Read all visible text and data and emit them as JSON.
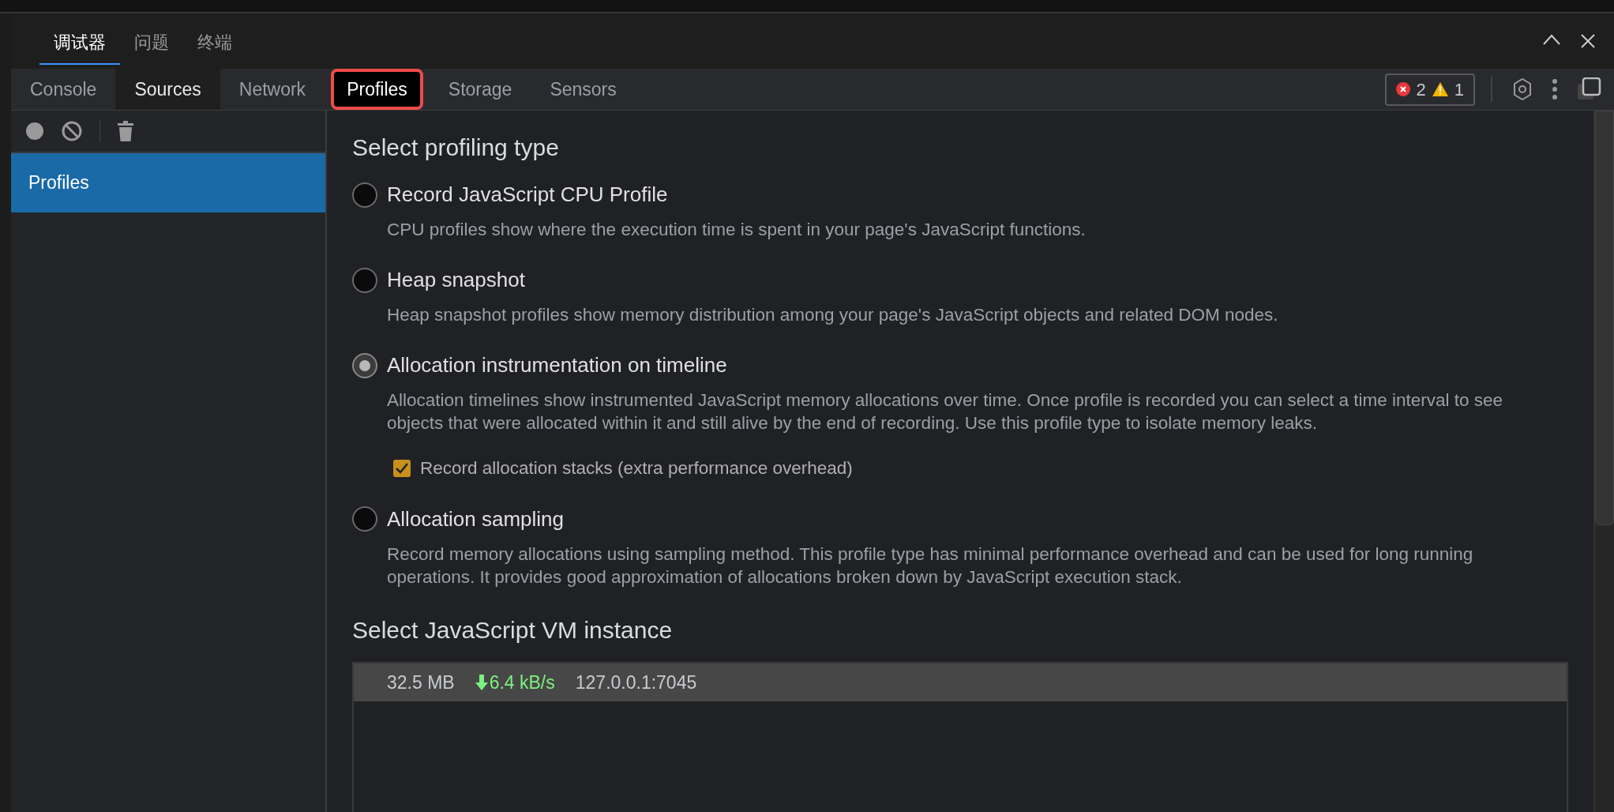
{
  "panel_tabs": [
    {
      "label": "调试器",
      "selected": true
    },
    {
      "label": "问题",
      "selected": false
    },
    {
      "label": "终端",
      "selected": false
    }
  ],
  "devtools_tabs": [
    {
      "label": "Console",
      "selected": false,
      "hover": false
    },
    {
      "label": "Sources",
      "selected": false,
      "hover": true
    },
    {
      "label": "Network",
      "selected": false,
      "hover": false
    },
    {
      "label": "Profiles",
      "selected": true,
      "hover": false
    },
    {
      "label": "Storage",
      "selected": false,
      "hover": false
    },
    {
      "label": "Sensors",
      "selected": false,
      "hover": false
    }
  ],
  "issues": {
    "errors": "2",
    "warnings": "1"
  },
  "sidebar": {
    "items": [
      {
        "label": "Profiles",
        "selected": true
      }
    ]
  },
  "profiling": {
    "title": "Select profiling type",
    "options": [
      {
        "label": "Record JavaScript CPU Profile",
        "selected": false,
        "description": "CPU profiles show where the execution time is spent in your page's JavaScript functions."
      },
      {
        "label": "Heap snapshot",
        "selected": false,
        "description": "Heap snapshot profiles show memory distribution among your page's JavaScript objects and related DOM nodes."
      },
      {
        "label": "Allocation instrumentation on timeline",
        "selected": true,
        "description": "Allocation timelines show instrumented JavaScript memory allocations over time. Once profile is recorded you can select a time interval to see objects that were allocated within it and still alive by the end of recording. Use this profile type to isolate memory leaks.",
        "option": {
          "label": "Record allocation stacks (extra performance overhead)",
          "checked": true
        }
      },
      {
        "label": "Allocation sampling",
        "selected": false,
        "description": "Record memory allocations using sampling method. This profile type has minimal performance overhead and can be used for long running operations. It provides good approximation of allocations broken down by JavaScript execution stack."
      }
    ]
  },
  "vm": {
    "title": "Select JavaScript VM instance",
    "instances": [
      {
        "memory": "32.5 MB",
        "rate": "6.4 kB/s",
        "address": "127.0.0.1:7045",
        "selected": true
      }
    ]
  }
}
